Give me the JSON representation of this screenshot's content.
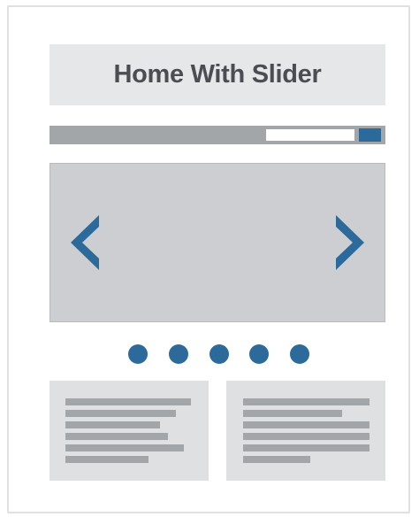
{
  "page": {
    "title": "Home With Slider"
  },
  "slider": {
    "slide_count": 5,
    "prev_icon": "chevron-left-icon",
    "next_icon": "chevron-right-icon"
  },
  "colors": {
    "accent": "#2d6a9c",
    "header_bg": "#e6e7e9",
    "placeholder_gray": "#a3a6a9",
    "slider_bg": "#ccced1",
    "card_bg": "#dfe0e2"
  }
}
